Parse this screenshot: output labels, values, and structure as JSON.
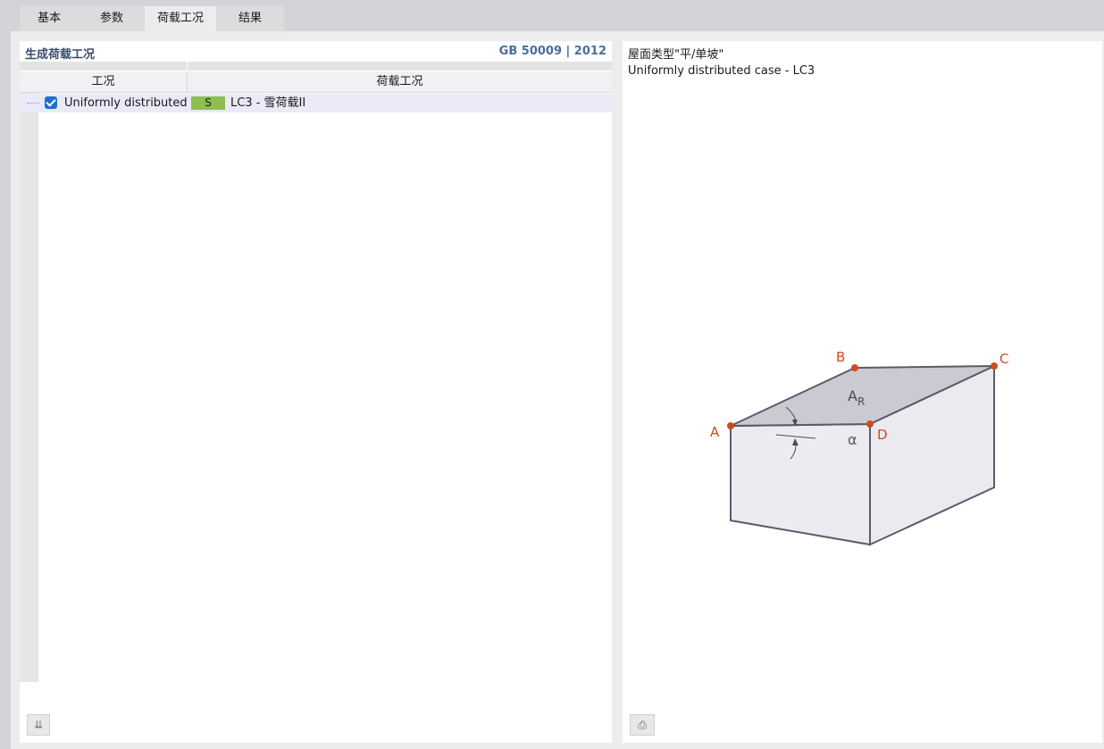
{
  "tabs": [
    {
      "label": "基本",
      "active": false
    },
    {
      "label": "参数",
      "active": false
    },
    {
      "label": "荷载工况",
      "active": true
    },
    {
      "label": "结果",
      "active": false
    }
  ],
  "left_panel": {
    "title": "生成荷载工况",
    "standard": "GB 50009 | 2012",
    "columns": [
      "工况",
      "荷载工况"
    ],
    "rows": [
      {
        "checked": true,
        "case": "Uniformly distributed case",
        "badge": "S",
        "badge_color": "#8dbf4f",
        "load_case": "LC3 - 雪荷载II"
      }
    ],
    "bottom_button_icon": "load-generate-icon"
  },
  "right_panel": {
    "roof_type": "屋面类型\"平/单坡\"",
    "case_label": "Uniformly distributed case - LC3",
    "diagram": {
      "points": [
        "A",
        "B",
        "C",
        "D"
      ],
      "area_label": "A",
      "area_subscript": "R",
      "angle_label": "α",
      "point_color": "#d24a1a",
      "edge_color": "#5a5a6a"
    },
    "bottom_button_icon": "print-icon"
  }
}
